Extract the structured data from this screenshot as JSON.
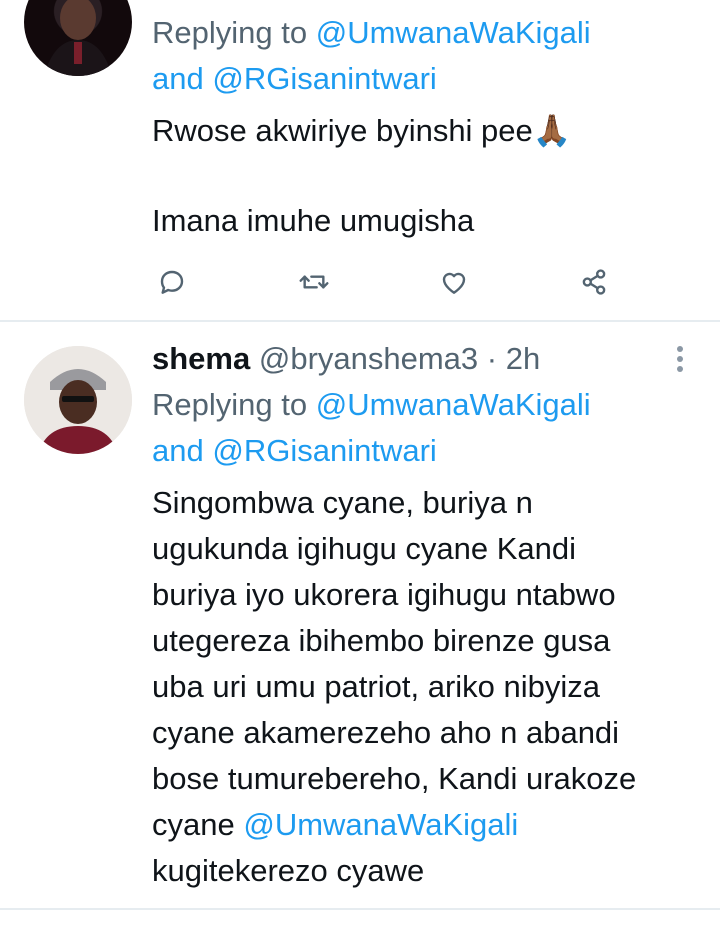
{
  "tweet1": {
    "replying_prefix": "Replying to",
    "mention1": "@UmwanaWaKigali",
    "and_word": "and",
    "mention2": "@RGisanintwari",
    "text_line1": "Rwose akwiriye byinshi pee🙏🏾",
    "text_line2": "Imana imuhe umugisha",
    "actions": [
      "reply-icon",
      "retweet-icon",
      "like-icon",
      "share-icon"
    ]
  },
  "tweet2": {
    "name": "shema",
    "handle": "@bryanshema3",
    "separator": "·",
    "time": "2h",
    "replying_prefix": "Replying to",
    "mention1": "@UmwanaWaKigali",
    "and_word": "and",
    "mention2": "@RGisanintwari",
    "body_lines": [
      "Singombwa cyane, buriya n",
      "ugukunda igihugu cyane Kandi",
      "buriya iyo ukorera igihugu ntabwo",
      "utegereza ibihembo birenze gusa",
      "uba uri umu patriot, ariko nibyiza",
      "cyane akamerezeho aho n abandi",
      "bose tumurebereho, Kandi urakoze"
    ],
    "body_line8_prefix": "cyane",
    "body_line8_mention": "@UmwanaWaKigali",
    "body_line9": "kugitekerezo cyawe"
  },
  "colors": {
    "link": "#1d9bf0",
    "secondary": "#536471",
    "divider": "#e6ecf0",
    "icon": "#536471"
  }
}
